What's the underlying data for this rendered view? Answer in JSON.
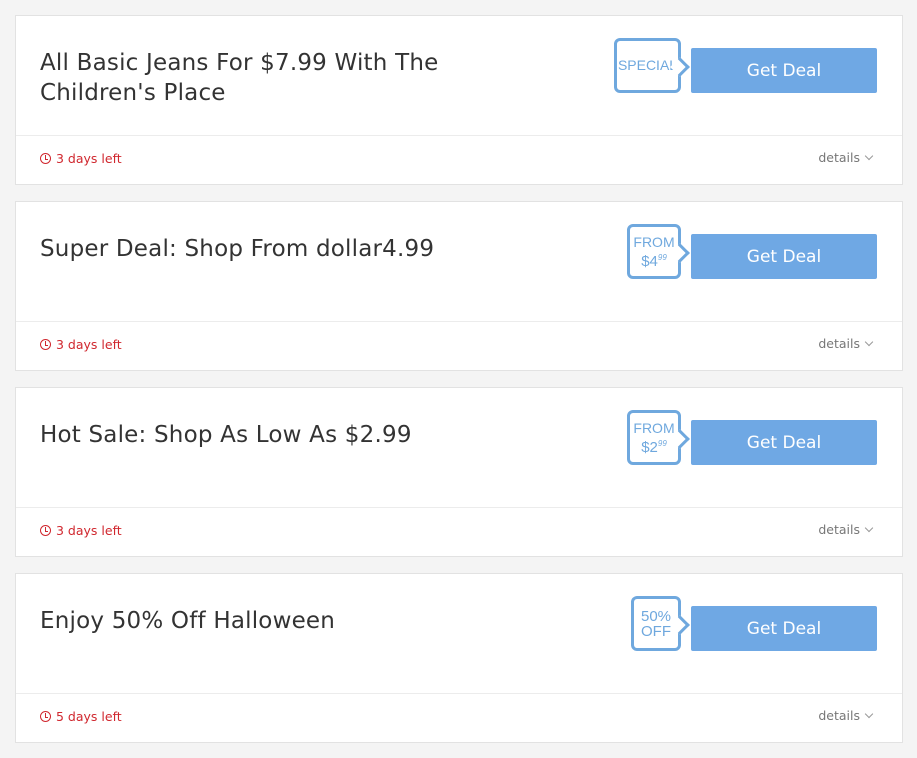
{
  "colors": {
    "accent": "#6fa8e4",
    "badge": "#6fa8de",
    "expiry": "#d0272e"
  },
  "deals": [
    {
      "title": "All Basic Jeans For $7.99 With The Children's Place",
      "badge": {
        "type": "special",
        "line1": "SPECIAL"
      },
      "button_label": "Get Deal",
      "expiry": "3 days left",
      "details_label": "details"
    },
    {
      "title": "Super Deal: Shop From dollar4.99",
      "badge": {
        "type": "from",
        "line1": "FROM",
        "amount": "$4",
        "cents": "99"
      },
      "button_label": "Get Deal",
      "expiry": "3 days left",
      "details_label": "details"
    },
    {
      "title": "Hot Sale: Shop As Low As $2.99",
      "badge": {
        "type": "from",
        "line1": "FROM",
        "amount": "$2",
        "cents": "99"
      },
      "button_label": "Get Deal",
      "expiry": "3 days left",
      "details_label": "details"
    },
    {
      "title": "Enjoy 50% Off Halloween",
      "badge": {
        "type": "pct",
        "line1": "50%",
        "line2": "OFF"
      },
      "button_label": "Get Deal",
      "expiry": "5 days left",
      "details_label": "details"
    }
  ]
}
